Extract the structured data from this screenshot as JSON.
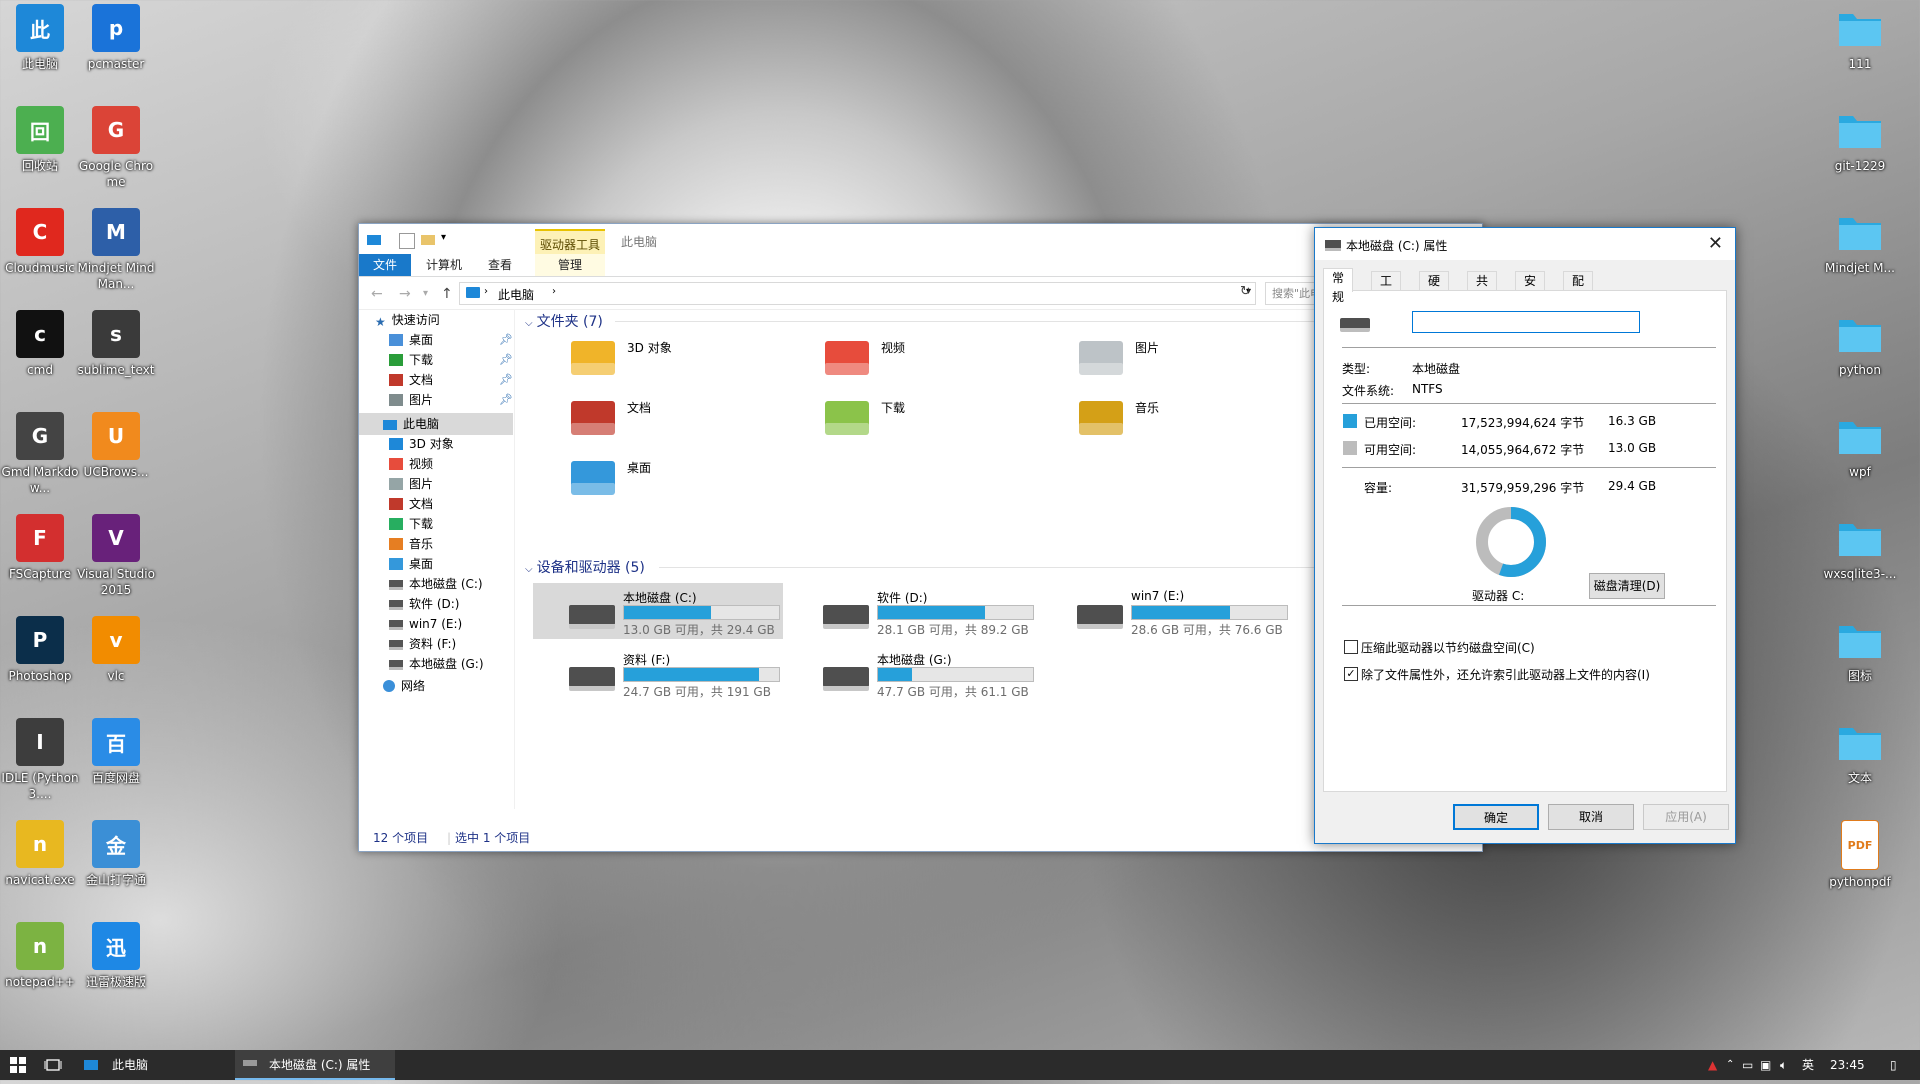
{
  "desktop": {
    "left_icons": [
      {
        "label": "此电脑",
        "icon": "this-pc-icon",
        "color": "#1e88d8"
      },
      {
        "label": "pcmaster",
        "icon": "pcmaster-icon",
        "color": "#1a73d9"
      },
      {
        "label": "回收站",
        "icon": "recycle-bin-icon",
        "color": "#4caf50"
      },
      {
        "label": "Google Chrome",
        "icon": "chrome-icon",
        "color": "#db4437"
      },
      {
        "label": "Cloudmusic",
        "icon": "cloudmusic-icon",
        "color": "#e0281e"
      },
      {
        "label": "Mindjet MindMan...",
        "icon": "mindjet-icon",
        "color": "#2d5fa8"
      },
      {
        "label": "cmd",
        "icon": "cmd-icon",
        "color": "#111111"
      },
      {
        "label": "sublime_text",
        "icon": "sublime-icon",
        "color": "#3a3a3a"
      },
      {
        "label": "Gmd Markdow...",
        "icon": "gmd-icon",
        "color": "#444444"
      },
      {
        "label": "UCBrows...",
        "icon": "ucbrowser-icon",
        "color": "#f18a1d"
      },
      {
        "label": "FSCapture",
        "icon": "fscapture-icon",
        "color": "#d32f2f"
      },
      {
        "label": "Visual Studio 2015",
        "icon": "visual-studio-icon",
        "color": "#68217a"
      },
      {
        "label": "Photoshop",
        "icon": "photoshop-icon",
        "color": "#0b2e4a"
      },
      {
        "label": "vlc",
        "icon": "vlc-icon",
        "color": "#f28c00"
      },
      {
        "label": "IDLE (Python 3....",
        "icon": "idle-icon",
        "color": "#3d3d3d"
      },
      {
        "label": "百度网盘",
        "icon": "baidu-netdisk-icon",
        "color": "#2a8ce6"
      },
      {
        "label": "navicat.exe",
        "icon": "navicat-icon",
        "color": "#e8b820"
      },
      {
        "label": "金山打字通",
        "icon": "kingsoft-typing-icon",
        "color": "#3b8fd6"
      },
      {
        "label": "notepad++",
        "icon": "notepadpp-icon",
        "color": "#7cb342"
      },
      {
        "label": "迅雷极速版",
        "icon": "xunlei-icon",
        "color": "#1e88e5"
      }
    ],
    "right_icons": [
      {
        "label": "111",
        "icon": "folder-icon"
      },
      {
        "label": "git-1229",
        "icon": "folder-icon"
      },
      {
        "label": "Mindjet M...",
        "icon": "folder-icon"
      },
      {
        "label": "python",
        "icon": "folder-icon"
      },
      {
        "label": "wpf",
        "icon": "folder-icon"
      },
      {
        "label": "wxsqlite3-...",
        "icon": "folder-icon"
      },
      {
        "label": "图标",
        "icon": "folder-icon"
      },
      {
        "label": "文本",
        "icon": "folder-icon"
      },
      {
        "label": "pythonpdf",
        "icon": "pdf-file-icon"
      }
    ]
  },
  "explorer": {
    "context_tab": "驱动器工具",
    "title": "此电脑",
    "ribbon_tabs": {
      "file": "文件",
      "computer": "计算机",
      "view": "查看",
      "manage": "管理"
    },
    "address": {
      "path": "此电脑",
      "separator": "›"
    },
    "search_placeholder": "搜索\"此电脑\"",
    "nav": {
      "quick_access": "快速访问",
      "quick_items": [
        "桌面",
        "下载",
        "文档",
        "图片"
      ],
      "this_pc": "此电脑",
      "pc_items": [
        "3D 对象",
        "视频",
        "图片",
        "文档",
        "下载",
        "音乐",
        "桌面",
        "本地磁盘 (C:)",
        "软件 (D:)",
        "win7 (E:)",
        "资料 (F:)",
        "本地磁盘 (G:)"
      ],
      "network": "网络"
    },
    "folders_header": "文件夹 (7)",
    "folders": [
      {
        "name": "3D 对象",
        "icon": "3d-objects-icon"
      },
      {
        "name": "视频",
        "icon": "videos-folder-icon"
      },
      {
        "name": "图片",
        "icon": "pictures-folder-icon"
      },
      {
        "name": "文档",
        "icon": "documents-folder-icon"
      },
      {
        "name": "下载",
        "icon": "downloads-folder-icon"
      },
      {
        "name": "音乐",
        "icon": "music-folder-icon"
      },
      {
        "name": "桌面",
        "icon": "desktop-folder-icon"
      }
    ],
    "drives_header": "设备和驱动器 (5)",
    "drives": [
      {
        "name": "本地磁盘 (C:)",
        "status": "13.0 GB 可用，共 29.4 GB",
        "used_fraction": 0.56
      },
      {
        "name": "软件 (D:)",
        "status": "28.1 GB 可用，共 89.2 GB",
        "used_fraction": 0.69
      },
      {
        "name": "win7 (E:)",
        "status": "28.6 GB 可用，共 76.6 GB",
        "used_fraction": 0.63
      },
      {
        "name": "资料 (F:)",
        "status": "24.7 GB 可用，共 191 GB",
        "used_fraction": 0.87
      },
      {
        "name": "本地磁盘 (G:)",
        "status": "47.7 GB 可用，共 61.1 GB",
        "used_fraction": 0.22
      }
    ],
    "status_items": "12 个项目",
    "status_selected": "选中 1 个项目"
  },
  "properties": {
    "title": "本地磁盘 (C:) 属性",
    "tabs": [
      "常规",
      "工具",
      "硬件",
      "共享",
      "安全",
      "配额"
    ],
    "name_value": "",
    "type_label": "类型:",
    "type_value": "本地磁盘",
    "fs_label": "文件系统:",
    "fs_value": "NTFS",
    "used_label": "已用空间:",
    "used_bytes": "17,523,994,624 字节",
    "used_gb": "16.3 GB",
    "free_label": "可用空间:",
    "free_bytes": "14,055,964,672 字节",
    "free_gb": "13.0 GB",
    "cap_label": "容量:",
    "cap_bytes": "31,579,959,296 字节",
    "cap_gb": "29.4 GB",
    "used_fraction": 0.555,
    "drive_label": "驱动器 C:",
    "cleanup_button": "磁盘清理(D)",
    "compress_label": "压缩此驱动器以节约磁盘空间(C)",
    "compress_checked": false,
    "index_label": "除了文件属性外，还允许索引此驱动器上文件的内容(I)",
    "index_checked": true,
    "ok": "确定",
    "cancel": "取消",
    "apply": "应用(A)",
    "colors": {
      "used": "#26a0da",
      "free": "#bcbcbc"
    }
  },
  "taskbar": {
    "apps": [
      {
        "label": "此电脑",
        "icon": "this-pc-icon"
      },
      {
        "label": "本地磁盘 (C:) 属性",
        "icon": "drive-icon"
      }
    ],
    "ime": "英",
    "time": "23:45"
  }
}
